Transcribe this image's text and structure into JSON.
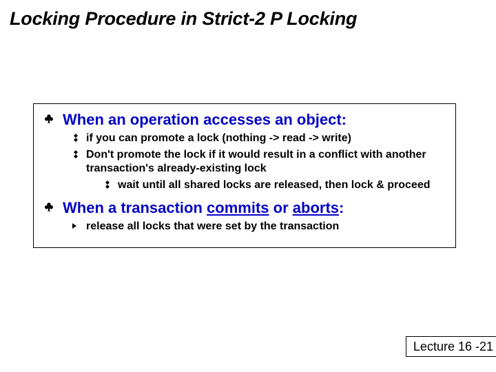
{
  "title": "Locking Procedure in Strict-2 P Locking",
  "section1": {
    "heading": "When an operation accesses an object:",
    "sub1": "if you can promote a lock (nothing -> read -> write)",
    "sub2": "Don't promote the lock if it would result in a conflict with another transaction's already-existing lock",
    "sub2a": "wait until all shared locks are released, then lock & proceed"
  },
  "section2": {
    "heading_pre": "When a transaction ",
    "heading_commits": "commits",
    "heading_or": " or ",
    "heading_aborts": "aborts",
    "heading_post": ":",
    "sub1": "release all locks that were set by the transaction"
  },
  "footer": "Lecture 16 -21"
}
